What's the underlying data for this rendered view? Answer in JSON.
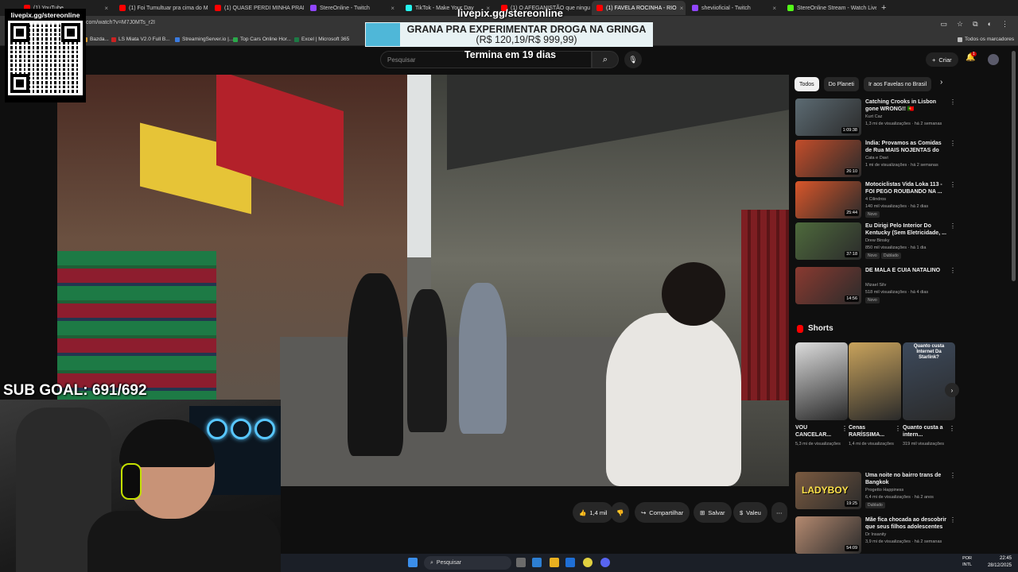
{
  "browser": {
    "tabs": [
      {
        "label": "(1) YouTube",
        "color": "#ff0000",
        "active": false
      },
      {
        "label": "(1) Foi Tumultuar pra cima do M",
        "color": "#ff0000",
        "active": false
      },
      {
        "label": "(1) QUASE PERDI MINHA PRAN",
        "color": "#ff0000",
        "active": false
      },
      {
        "label": "StereOnline - Twitch",
        "color": "#9146ff",
        "active": false
      },
      {
        "label": "TikTok - Make Your Day",
        "color": "#25f4ee",
        "active": false
      },
      {
        "label": "(1) O AFEGANISTÃO que ninguém",
        "color": "#ff0000",
        "active": false
      },
      {
        "label": "(1) FAVELA ROCINHA - RIO",
        "color": "#ff0000",
        "active": true
      },
      {
        "label": "sheviioficial - Twitch",
        "color": "#9146ff",
        "active": false
      },
      {
        "label": "StereOnline Stream - Watch Live",
        "color": "#53fc18",
        "active": false
      }
    ],
    "url": "com/watch?v=M7J0MTs_r2I",
    "bookmarks": [
      {
        "label": "Bazda...",
        "color": "#e0a030"
      },
      {
        "label": "LS Miata V2.0 Full B...",
        "color": "#cc2222"
      },
      {
        "label": "StreamingServer.io |...",
        "color": "#3a7be0"
      },
      {
        "label": "Top Cars Online Hor...",
        "color": "#2aa84a"
      },
      {
        "label": "Excel | Microsoft 365",
        "color": "#1d7a45"
      },
      {
        "label": "Todos os marcadores",
        "color": "#bbbbbb"
      }
    ]
  },
  "youtube": {
    "search_placeholder": "Pesquisar",
    "create_label": "Criar",
    "notif_count": "1"
  },
  "overlay": {
    "qr_label": "livepix.gg/stereonline",
    "promo_url": "livepix.gg/stereonline",
    "promo_title": "GRANA PRA EXPERIMENTAR DROGA NA GRINGA",
    "promo_amount": "(R$ 120,19/R$ 999,99)",
    "promo_progress": 0.12,
    "countdown": "Termina em 19 dias",
    "sub_goal": "SUB GOAL: 691/692"
  },
  "actions": {
    "likes": "1,4 mil",
    "share": "Compartilhar",
    "save": "Salvar",
    "thanks": "Valeu"
  },
  "sidebar": {
    "chips": [
      "Todos",
      "Do Planeti",
      "Ir aos Favelas no Brasil"
    ],
    "recommendations": [
      {
        "title": "Catching Crooks in Lisbon gone WRONG!! 🇵🇹",
        "channel": "Kurt Caz",
        "meta": "1,3 mi de visualizações · há 2 semanas",
        "duration": "1:09:38",
        "badges": []
      },
      {
        "title": "Índia: Provamos as Comidas de Rua MAIS NOJENTAS do país!",
        "channel": "Cata e Davi",
        "meta": "1 mi de visualizações · há 2 semanas",
        "duration": "26:10",
        "badges": []
      },
      {
        "title": "Motociclistas Vida Loka 113 - FOI PEGO ROUBANDO NA ...",
        "channel": "4 Cilindros",
        "meta": "140 mil visualizações · há 2 dias",
        "duration": "25:44",
        "badges": [
          "Novo"
        ]
      },
      {
        "title": "Eu Dirigi Pelo Interior Do Kentucky (Sem Eletricidade, ...",
        "channel": "Drew Binsky",
        "meta": "850 mil visualizações · há 1 dia",
        "duration": "37:18",
        "badges": [
          "Novo",
          "Dublado"
        ]
      },
      {
        "title": "DE MALA E CUIA NATALINO",
        "channel": "Mizael Silv",
        "meta": "518 mil visualizações · há 4 dias",
        "duration": "14:56",
        "badges": [
          "Novo"
        ]
      }
    ],
    "shorts_label": "Shorts",
    "shorts": [
      {
        "title": "VOU CANCELAR...",
        "views": "5,3 mi de visualizações"
      },
      {
        "title": "Cenas RARÍSSIMA...",
        "views": "1,4 mi de visualizações"
      },
      {
        "title": "Quanto custa a intern...",
        "views": "319 mil visualizações"
      }
    ],
    "shorts_overlay_text": "Quanto custa Internet Da Starlink?",
    "more": [
      {
        "title": "Uma noite no bairro trans de Bangkok",
        "channel": "Progetto Happiness",
        "meta": "6,4 mi de visualizações · há 2 anos",
        "duration": "19:25",
        "thumb_text": "LADYBOY",
        "badges": [
          "Dublado"
        ]
      },
      {
        "title": "Mãe fica chocada ao descobrir que seus filhos adolescentes ...",
        "channel": "Dr Insanity",
        "meta": "3,9 mi de visualizações · há 2 semanas",
        "duration": "54:09",
        "thumb_text": "",
        "badges": []
      }
    ]
  },
  "taskbar": {
    "search": "Pesquisar",
    "lang": [
      "POR",
      "INTL"
    ],
    "time": "22:45",
    "date": "28/12/2025"
  },
  "icons": [
    "search-icon",
    "mic-icon",
    "bell-icon",
    "plus-icon",
    "like-icon",
    "dislike-icon",
    "share-icon",
    "save-icon",
    "thanks-icon",
    "kebab-icon",
    "chevron-right-icon",
    "windows-icon"
  ]
}
